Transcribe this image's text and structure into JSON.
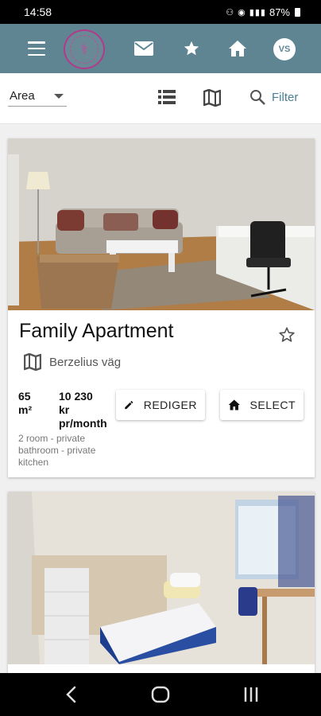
{
  "status_bar": {
    "time": "14:58",
    "signal_icons": "⚇ ◉ ▮▮▮",
    "battery": "87%"
  },
  "app_bar": {
    "avatar_initials": "VS",
    "colors": {
      "bar": "#5f8593",
      "logo_ring": "#b23a8a"
    }
  },
  "toolbar": {
    "area_label": "Area",
    "filter_label": "Filter",
    "accent": "#4a7f92"
  },
  "listings": [
    {
      "title": "Family Apartment",
      "location": "Berzelius väg",
      "size_value": "65",
      "size_unit": "m²",
      "price_value": "10 230",
      "price_unit": "kr",
      "price_period": "pr/month",
      "description": "2 room - private bathroom - private kitchen",
      "edit_label": "REDIGER",
      "select_label": "SELECT"
    }
  ],
  "icons": [
    "menu-icon",
    "mail-icon",
    "star-icon",
    "home-icon",
    "list-view-icon",
    "map-view-icon",
    "search-icon",
    "map-icon",
    "pencil-icon",
    "back-icon",
    "home-nav-icon",
    "recents-icon"
  ]
}
